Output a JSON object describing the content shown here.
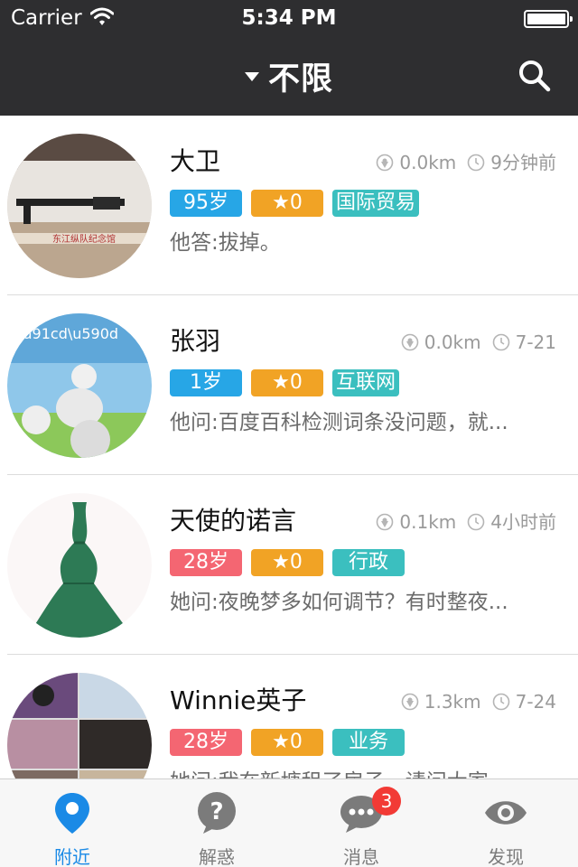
{
  "status_bar": {
    "carrier": "Carrier",
    "time": "5:34 PM"
  },
  "nav": {
    "title": "不限",
    "filter_icon": "caret-down-icon",
    "search_icon": "search-icon"
  },
  "users": [
    {
      "name": "大卫",
      "distance": "0.0km",
      "time": "9分钟前",
      "age": "95岁",
      "age_color": "blue",
      "stars": "★0",
      "category": "国际贸易",
      "question": "他答:拔掉。"
    },
    {
      "name": "张羽",
      "distance": "0.0km",
      "time": "7-21",
      "age": "1岁",
      "age_color": "blue",
      "stars": "★0",
      "category": "互联网",
      "question": "他问:百度百科检测词条没问题，就..."
    },
    {
      "name": "天使的诺言",
      "distance": "0.1km",
      "time": "4小时前",
      "age": "28岁",
      "age_color": "pink",
      "stars": "★0",
      "category": "行政",
      "question": "她问:夜晚梦多如何调节？有时整夜..."
    },
    {
      "name": "Winnie英子",
      "distance": "1.3km",
      "time": "7-24",
      "age": "28岁",
      "age_color": "pink",
      "stars": "★0",
      "category": "业务",
      "question": "她问:我在新塘租了房子，请问大家..."
    }
  ],
  "tabbar": {
    "tabs": [
      {
        "label": "附近",
        "icon": "location-pin-icon",
        "active": true
      },
      {
        "label": "解惑",
        "icon": "question-bubble-icon",
        "active": false
      },
      {
        "label": "消息",
        "icon": "chat-bubble-icon",
        "active": false,
        "badge": "3"
      },
      {
        "label": "发现",
        "icon": "eye-icon",
        "active": false
      }
    ]
  },
  "colors": {
    "header_bg": "#2e2e30",
    "age_blue": "#27a6e6",
    "age_pink": "#f46672",
    "star_orange": "#f1a325",
    "category_teal": "#3bbfbf",
    "active_tab": "#1a8ae6"
  }
}
